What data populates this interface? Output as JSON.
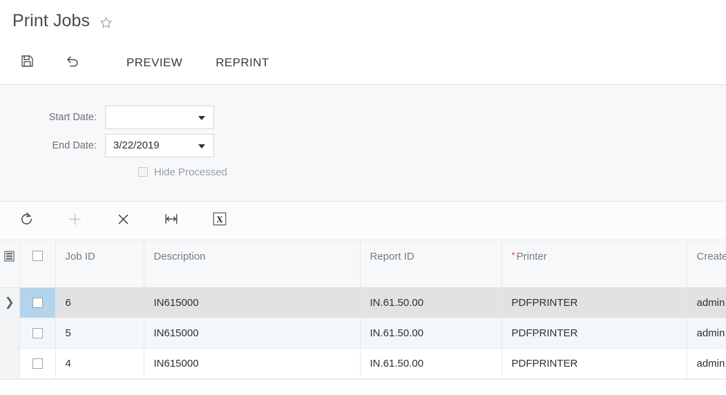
{
  "header": {
    "title": "Print Jobs",
    "favorite_icon": "star-icon"
  },
  "action_toolbar": {
    "save_label": "save-icon",
    "undo_label": "undo-icon",
    "preview_label": "PREVIEW",
    "reprint_label": "REPRINT"
  },
  "filters": {
    "start_date": {
      "label": "Start Date:",
      "value": ""
    },
    "end_date": {
      "label": "End Date:",
      "value": "3/22/2019"
    },
    "hide_processed": {
      "label": "Hide Processed",
      "checked": false
    }
  },
  "grid_toolbar": {
    "buttons": [
      {
        "name": "refresh-icon",
        "title": "Refresh"
      },
      {
        "name": "add-icon",
        "title": "Add Row"
      },
      {
        "name": "delete-icon",
        "title": "Delete Row"
      },
      {
        "name": "fit-columns-icon",
        "title": "Fit Columns"
      },
      {
        "name": "export-excel-icon",
        "title": "Export to Excel"
      }
    ]
  },
  "grid": {
    "columns": [
      {
        "key": "job_id",
        "label": "Job ID",
        "required": false
      },
      {
        "key": "description",
        "label": "Description",
        "required": false
      },
      {
        "key": "report_id",
        "label": "Report ID",
        "required": false
      },
      {
        "key": "printer",
        "label": "Printer",
        "required": true
      },
      {
        "key": "created",
        "label": "Create",
        "required": false
      }
    ],
    "rows": [
      {
        "job_id": "6",
        "description": "IN615000",
        "report_id": "IN.61.50.00",
        "printer": "PDFPRINTER",
        "created": "admin",
        "selected": true,
        "checked": false
      },
      {
        "job_id": "5",
        "description": "IN615000",
        "report_id": "IN.61.50.00",
        "printer": "PDFPRINTER",
        "created": "admin",
        "selected": false,
        "checked": false
      },
      {
        "job_id": "4",
        "description": "IN615000",
        "report_id": "IN.61.50.00",
        "printer": "PDFPRINTER",
        "created": "admin",
        "selected": false,
        "checked": false
      }
    ],
    "select_all_checked": false
  },
  "colors": {
    "accent_selected_check": "#b3d4ea",
    "selected_row": "#e0e2e4",
    "alt_row": "#f4f7f9",
    "required_marker": "#e4443c",
    "panel_bg": "#f7f8f9"
  }
}
